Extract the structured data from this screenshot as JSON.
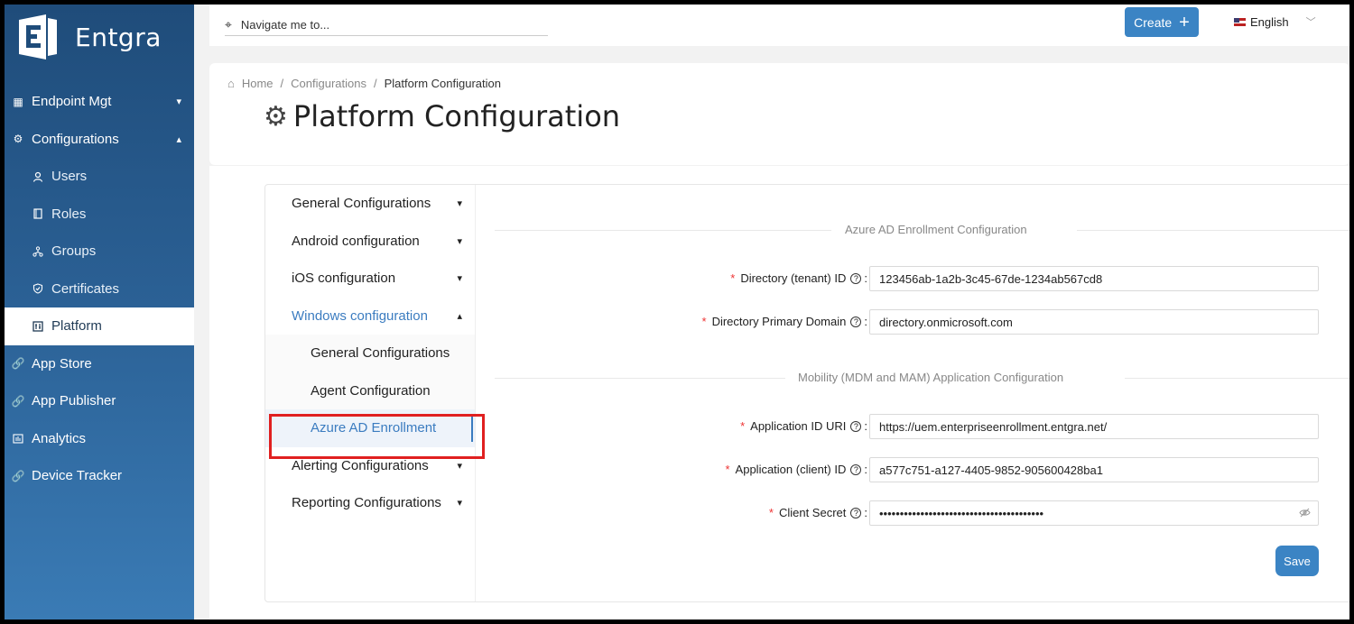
{
  "app": {
    "brand": "Entgra"
  },
  "topbar": {
    "search_placeholder": "Navigate me to...",
    "create_label": "Create",
    "language": "English"
  },
  "sidebar": {
    "items": [
      {
        "label": "Endpoint Mgt",
        "icon": "grid-icon"
      },
      {
        "label": "Configurations",
        "icon": "gear-icon"
      },
      {
        "label": "Users",
        "icon": "user-icon"
      },
      {
        "label": "Roles",
        "icon": "book-icon"
      },
      {
        "label": "Groups",
        "icon": "cluster-icon"
      },
      {
        "label": "Certificates",
        "icon": "shield-icon"
      },
      {
        "label": "Platform",
        "icon": "platform-icon"
      },
      {
        "label": "App Store",
        "icon": "link-icon"
      },
      {
        "label": "App Publisher",
        "icon": "link-icon"
      },
      {
        "label": "Analytics",
        "icon": "chart-icon"
      },
      {
        "label": "Device Tracker",
        "icon": "link-icon"
      }
    ]
  },
  "breadcrumb": {
    "home": "Home",
    "mid": "Configurations",
    "current": "Platform Configuration"
  },
  "page": {
    "title": "Platform Configuration"
  },
  "menu": {
    "items": [
      "General Configurations",
      "Android configuration",
      "iOS configuration",
      "Windows configuration",
      "General Configurations",
      "Agent Configuration",
      "Azure AD Enrollment",
      "Alerting Configurations",
      "Reporting Configurations"
    ]
  },
  "form": {
    "section1": "Azure AD Enrollment Configuration",
    "section2": "Mobility (MDM and MAM) Application Configuration",
    "fields": [
      {
        "label": "Directory (tenant) ID",
        "value": "123456ab-1a2b-3c45-67de-1234ab567cd8"
      },
      {
        "label": "Directory Primary Domain",
        "value": "directory.onmicrosoft.com"
      },
      {
        "label": "Application ID URI",
        "value": "https://uem.enterpriseenrollment.entgra.net/"
      },
      {
        "label": "Application (client) ID",
        "value": "a577c751-a127-4405-9852-905600428ba1"
      },
      {
        "label": "Client Secret",
        "value": "••••••••••••••••••••••••••••••••••••••••"
      }
    ],
    "save_label": "Save"
  }
}
